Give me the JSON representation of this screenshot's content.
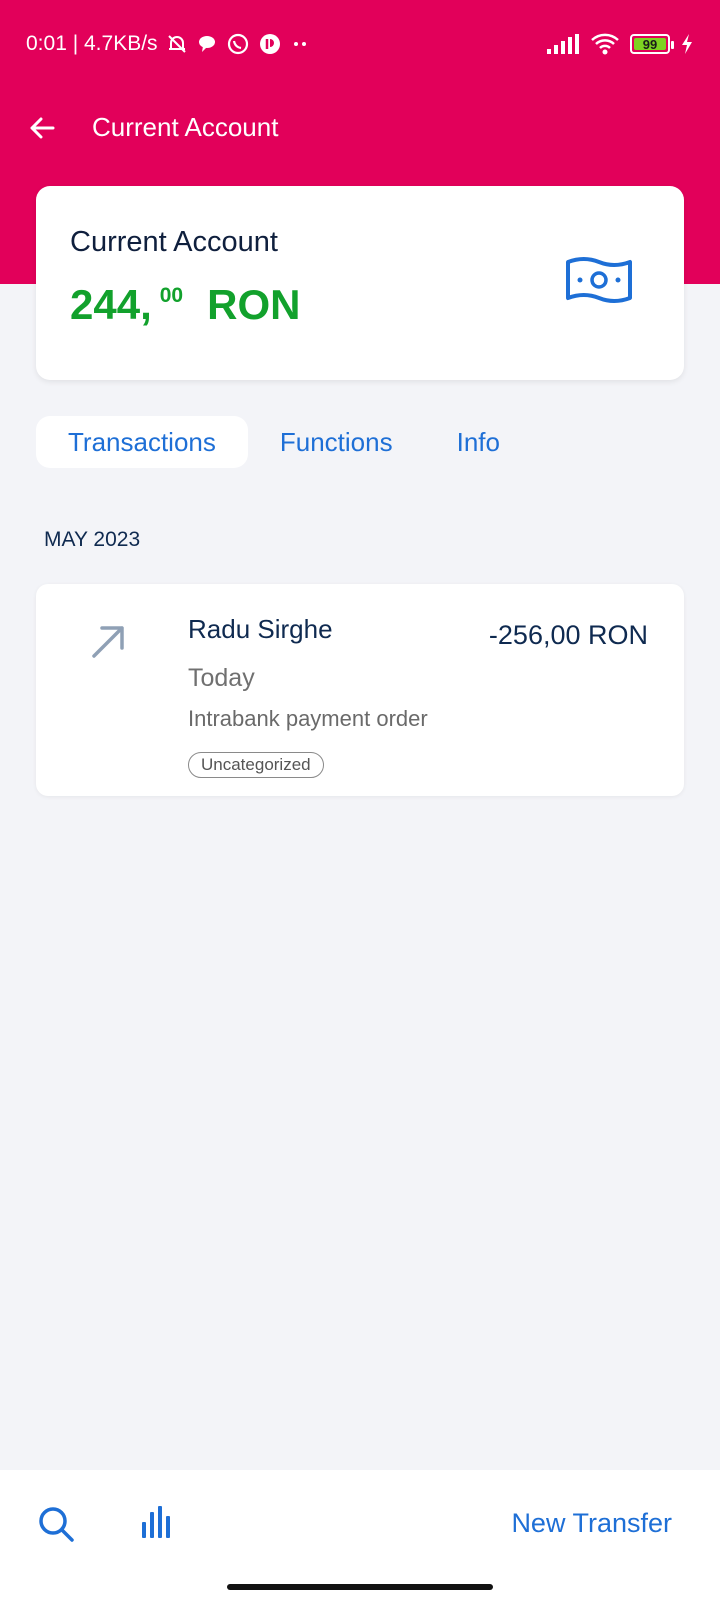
{
  "status_bar": {
    "time_speed": "0:01 | 4.7KB/s",
    "battery": "99"
  },
  "app_bar": {
    "title": "Current Account"
  },
  "account": {
    "name": "Current Account",
    "balance_int": "244,",
    "balance_dec": "00",
    "currency": "RON"
  },
  "tabs": [
    {
      "label": "Transactions",
      "active": true
    },
    {
      "label": "Functions",
      "active": false
    },
    {
      "label": "Info",
      "active": false
    }
  ],
  "month": "MAY 2023",
  "transactions": [
    {
      "name": "Radu Sirghe",
      "amount": "-256,00 RON",
      "date": "Today",
      "description": "Intrabank payment order",
      "tag": "Uncategorized"
    }
  ],
  "bottom_bar": {
    "new_transfer_label": "New Transfer"
  },
  "colors": {
    "brand": "#e2005a",
    "balance_green": "#12a12c",
    "link_blue": "#1e6fd6"
  }
}
